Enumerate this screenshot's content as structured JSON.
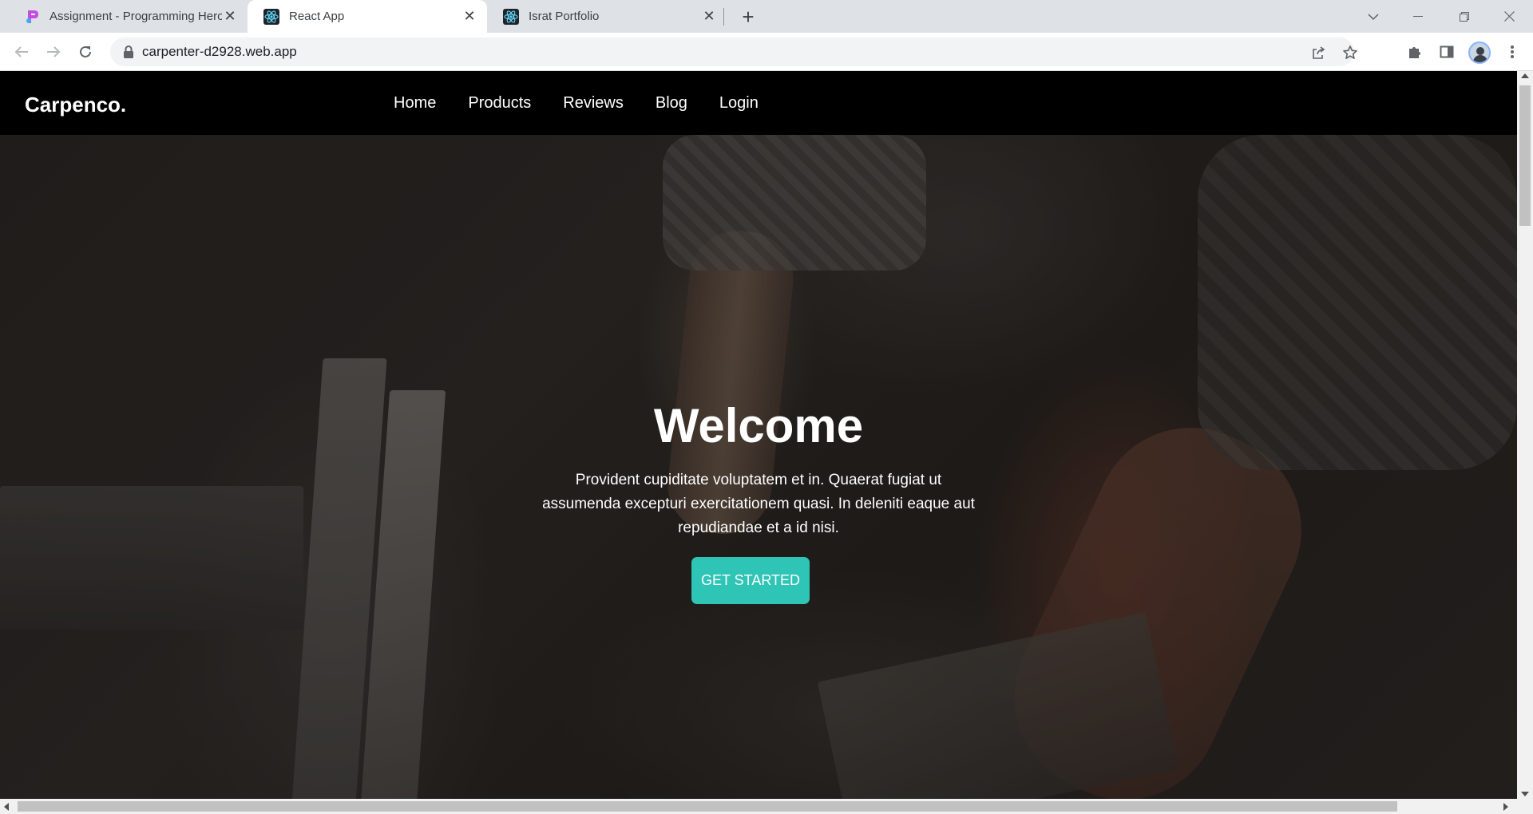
{
  "browser": {
    "tabs": [
      {
        "title": "Assignment - Programming Hero",
        "icon": "programming-hero-logo",
        "active": false
      },
      {
        "title": "React App",
        "icon": "react-logo",
        "active": true
      },
      {
        "title": "Israt Portfolio",
        "icon": "react-logo",
        "active": false
      }
    ],
    "address": {
      "url": "carpenter-d2928.web.app"
    }
  },
  "site": {
    "brand": "Carpenco.",
    "nav": [
      "Home",
      "Products",
      "Reviews",
      "Blog",
      "Login"
    ],
    "hero": {
      "title": "Welcome",
      "text": "Provident cupiditate voluptatem et in. Quaerat fugiat ut assumenda excepturi exercitationem quasi. In deleniti eaque aut repudiandae et a id nisi.",
      "cta": "GET STARTED"
    }
  },
  "colors": {
    "nav_bg": "#000000",
    "cta_bg": "#2ec4b6",
    "tabstrip_bg": "#dee1e6"
  }
}
